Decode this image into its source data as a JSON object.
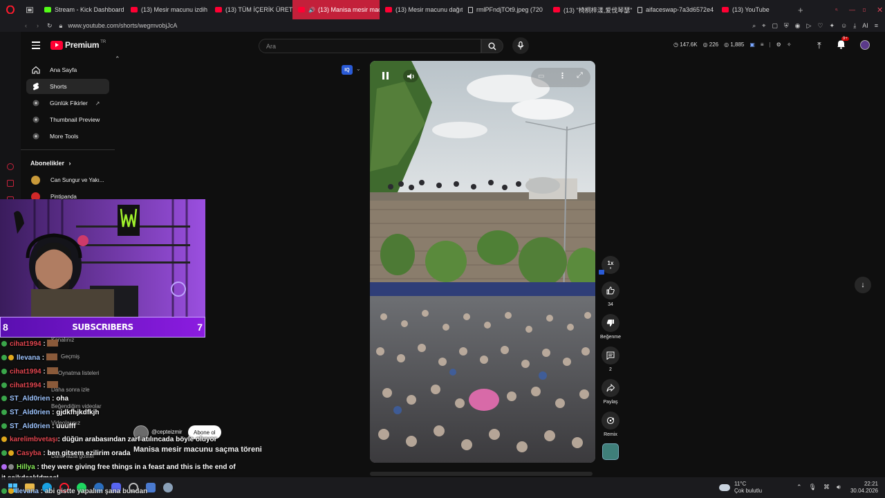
{
  "tabs": [
    {
      "label": "",
      "icon": "opera-icon"
    },
    {
      "label": "",
      "icon": "tab-overview-icon"
    },
    {
      "label": "Stream - Kick Dashboard",
      "icon": "kick"
    },
    {
      "label": "(13) Mesir macunu izdih",
      "icon": "yt"
    },
    {
      "label": "(13) TÜM İÇERİK ÜRETİC",
      "icon": "yt"
    },
    {
      "label": "(13) Manisa mesir mac",
      "icon": "yt",
      "active": true
    },
    {
      "label": "(13) Mesir macunu dağıt",
      "icon": "yt"
    },
    {
      "label": "rmlPFndjTOt9.jpeg (720",
      "icon": "doc"
    },
    {
      "label": "(13) \"椅桐梓漾,爱伐琴瑟\"",
      "icon": "yt"
    },
    {
      "label": "aifaceswap-7a3d6572e4",
      "icon": "doc"
    },
    {
      "label": "(13) YouTube",
      "icon": "yt"
    }
  ],
  "address": {
    "url": "www.youtube.com/shorts/wegmvobjJcA"
  },
  "header": {
    "logo_text": "Premium",
    "logo_sup": "TR",
    "search_placeholder": "Ara",
    "stats": {
      "views": "147.6K",
      "likes": "226",
      "other": "1,885"
    },
    "notif_badge": "9+"
  },
  "sidebar": {
    "items": [
      {
        "label": "Ana Sayfa",
        "icon": "home-icon"
      },
      {
        "label": "Shorts",
        "icon": "shorts-icon",
        "selected": true
      },
      {
        "label": "Günlük Fikirler",
        "icon": "bulb-icon"
      },
      {
        "label": "Thumbnail Preview",
        "icon": "image-icon"
      },
      {
        "label": "More Tools",
        "icon": "tools-icon"
      }
    ],
    "subs_header": "Abonelikler",
    "subs": [
      {
        "label": "Can Sungur ve Yakı..."
      },
      {
        "label": "Pintipanda"
      }
    ],
    "hidden_items": [
      "Kanalınız",
      "Geçmiş",
      "Oynatma listeleri",
      "Daha sonra izle",
      "Beğendiğim videolar",
      "Videolarınız",
      "Daha fazla göster"
    ]
  },
  "video": {
    "channel": "@cepteizmir",
    "subscribe_label": "Abone ol",
    "title": "Manisa mesir macunu saçma töreni",
    "actions": {
      "speed": "1x",
      "likes": "34",
      "dislike_label": "Beğenme",
      "comments": "2",
      "share_label": "Paylaş",
      "remix_label": "Remix"
    }
  },
  "overlay": {
    "subscribers_label": "SUBSCRIBERS",
    "left_num": "8",
    "right_num": "7"
  },
  "chat": [
    {
      "user": "cihat1994",
      "msg": "",
      "color": "#e0464f",
      "dot": "#3aa64a"
    },
    {
      "user": "llevana",
      "msg": "",
      "color": "#9ec5ff",
      "dot": "#e0a81c"
    },
    {
      "user": "cihat1994",
      "msg": "",
      "color": "#e0464f",
      "dot": "#3aa64a"
    },
    {
      "user": "cihat1994",
      "msg": "",
      "color": "#e0464f",
      "dot": "#3aa64a"
    },
    {
      "user": "ST_Ald0rien",
      "msg": "oha",
      "color": "#9ec5ff",
      "dot": "#3aa64a"
    },
    {
      "user": "ST_Ald0rien",
      "msg": "gjdkfhjkdfkjh",
      "color": "#9ec5ff",
      "dot": "#3aa64a"
    },
    {
      "user": "ST_Ald0rien",
      "msg": "uuufff",
      "color": "#9ec5ff",
      "dot": "#3aa64a"
    },
    {
      "user": "karelimbvetaşı",
      "msg": "düğün arabasından zarf atılıncada böyle oluyor",
      "color": "#e0464f",
      "dot": "#e0a81c"
    },
    {
      "user": "Casyba",
      "msg": "ben gitsem ezilirim orada",
      "color": "#e0464f",
      "dot": "#e0a81c"
    },
    {
      "user": "Hillya",
      "msg": "they were giving free things in a feast and this is the end of",
      "color": "#8bf05a",
      "dot": "#b06af0"
    },
    {
      "user": "",
      "msg": "it sajkdsakldmasl",
      "color": "#fff",
      "dot": ""
    },
    {
      "user": "llevana",
      "msg": "abi gistte yapalım şana bundan",
      "color": "#9ec5ff",
      "dot": "#3aa64a"
    }
  ],
  "taskbar": {
    "weather_temp": "11°C",
    "weather_desc": "Çok bulutlu",
    "time": "22:21",
    "date": "30.04.2026"
  }
}
